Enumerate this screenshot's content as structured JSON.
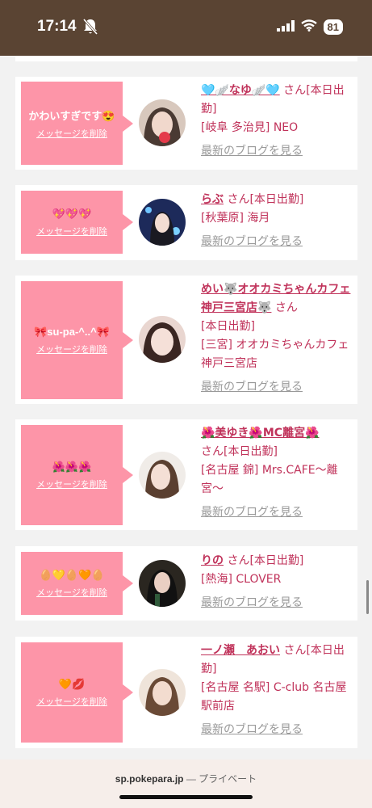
{
  "status": {
    "time": "17:14",
    "battery": "81"
  },
  "cards": [
    {
      "message": "かわいすぎです😍",
      "delete_label": "メッセージを削除",
      "name": "🩵🪽なゆ🪽🩵",
      "san": " さん",
      "status": "[本日出勤]",
      "location": "[岐阜 多治見] NEO",
      "blog_label": "最新のブログを見る"
    },
    {
      "message": "💖💖💖",
      "delete_label": "メッセージを削除",
      "name": "らぶ",
      "san": " さん",
      "status": "[本日出勤]",
      "location": "[秋葉原] 海月",
      "blog_label": "最新のブログを見る"
    },
    {
      "message": "🎀su-pa-^..^🎀",
      "delete_label": "メッセージを削除",
      "name": "めい🐺オオカミちゃんカフェ神戸三宮店🐺",
      "san": " さん",
      "status": "[本日出勤]",
      "location": "[三宮] オオカミちゃんカフェ神戸三宮店",
      "blog_label": "最新のブログを見る"
    },
    {
      "message": "🌺🌺🌺",
      "delete_label": "メッセージを削除",
      "name": "🌺美ゆき🌺MC離宮🌺",
      "san": " さん",
      "status": "[本日出勤]",
      "location": "[名古屋 錦] Mrs.CAFE〜離宮〜",
      "blog_label": "最新のブログを見る"
    },
    {
      "message": "🥚💛🥚🧡🥚",
      "delete_label": "メッセージを削除",
      "name": "りの",
      "san": " さん",
      "status": "[本日出勤]",
      "location": "[熱海] CLOVER",
      "blog_label": "最新のブログを見る"
    },
    {
      "message": "🧡💋",
      "delete_label": "メッセージを削除",
      "name": "一ノ瀬　あおい",
      "san": " さん",
      "status": "[本日出勤]",
      "location": "[名古屋 名駅] C-club 名古屋駅前店",
      "blog_label": "最新のブログを見る"
    }
  ],
  "browser": {
    "domain": "sp.pokepara.jp",
    "mode": "— プライベート"
  }
}
